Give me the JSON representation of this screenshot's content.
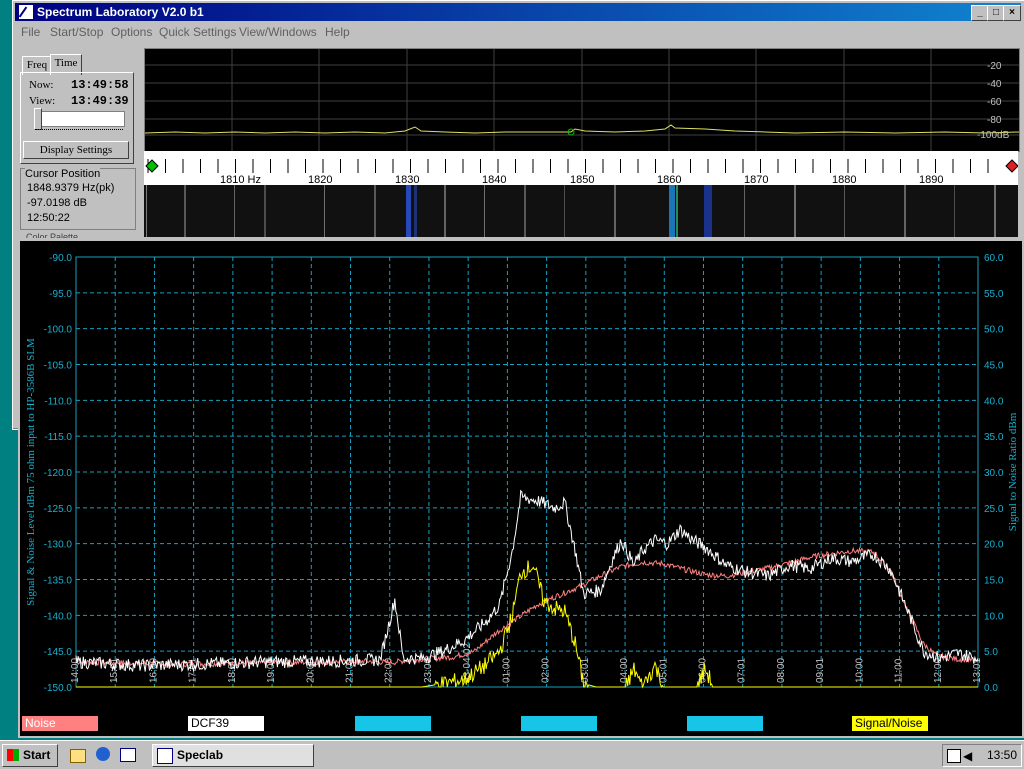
{
  "window": {
    "title": "Spectrum Laboratory V2.0 b1"
  },
  "menu": [
    "File",
    "Start/Stop",
    "Options",
    "Quick Settings",
    "View/Windows",
    "Help"
  ],
  "tabs": {
    "freq": "Freq",
    "time": "Time"
  },
  "time_panel": {
    "now_label": "Now:",
    "now_value": "13:49:58",
    "view_label": "View:",
    "view_value": "13:49:39",
    "display_settings": "Display Settings"
  },
  "cursor": {
    "title": "Cursor Position",
    "freq": "1848.9379 Hz(pk)",
    "level": "-97.0198 dB",
    "time": "12:50:22",
    "palette_label": "Color Palette"
  },
  "spectrum": {
    "db_ticks": [
      "-20",
      "-40",
      "-60",
      "-80",
      "-100dB"
    ]
  },
  "ruler": {
    "ticks": [
      "1810 Hz",
      "1820",
      "1830",
      "1840",
      "1850",
      "1860",
      "1870",
      "1880",
      "1890"
    ]
  },
  "chart_data": {
    "type": "line",
    "ylabel_left": "Signal & Noise Level dBm 75 ohm input to HP-3586B SLM",
    "ylabel_right": "Signal to Noise Ratio dBm",
    "y_left_ticks": [
      "-90.0",
      "-95.0",
      "-100.0",
      "-105.0",
      "-110.0",
      "-115.0",
      "-120.0",
      "-125.0",
      "-130.0",
      "-135.0",
      "-140.0",
      "-145.0",
      "-150.0"
    ],
    "y_right_ticks": [
      "60.0",
      "55.0",
      "50.0",
      "45.0",
      "40.0",
      "35.0",
      "30.0",
      "25.0",
      "20.0",
      "15.0",
      "10.0",
      "5.0",
      "0.0"
    ],
    "ylim_left": [
      -150,
      -90
    ],
    "ylim_right": [
      0,
      60
    ],
    "x_ticks": [
      "14:00",
      "15:01",
      "16:00",
      "17:01",
      "18:00",
      "19:01",
      "20:00",
      "21:01",
      "22:00",
      "23:00",
      "03-04-02",
      "01:00",
      "02:00",
      "03:01",
      "04:00",
      "05:01",
      "06:00",
      "07:01",
      "08:00",
      "09:01",
      "10:00",
      "11:00",
      "12:00",
      "13:01"
    ],
    "grid": true,
    "series": [
      {
        "name": "Noise",
        "color": "#ff8080",
        "points": [
          [
            0,
            -146.5
          ],
          [
            5,
            -146.8
          ],
          [
            10,
            -146.6
          ],
          [
            14,
            -146.4
          ],
          [
            15,
            -146.6
          ],
          [
            16,
            -146.2
          ],
          [
            18,
            -145.8
          ],
          [
            19,
            -145.0
          ],
          [
            20,
            -142.5
          ],
          [
            21,
            -140.5
          ],
          [
            22,
            -138.5
          ],
          [
            23,
            -137.2
          ],
          [
            24,
            -136.0
          ],
          [
            25,
            -134.5
          ],
          [
            26,
            -133.2
          ],
          [
            27,
            -132.6
          ],
          [
            28,
            -132.8
          ],
          [
            29,
            -133.6
          ],
          [
            30,
            -134.3
          ],
          [
            31,
            -134.5
          ],
          [
            32,
            -134.0
          ],
          [
            33,
            -133.4
          ],
          [
            34,
            -132.7
          ],
          [
            35,
            -131.9
          ],
          [
            36,
            -131.4
          ],
          [
            37,
            -131.0
          ],
          [
            38,
            -131.2
          ],
          [
            38.8,
            -133.5
          ],
          [
            39.6,
            -139.0
          ],
          [
            40.4,
            -144.0
          ],
          [
            41,
            -145.6
          ],
          [
            42,
            -146.1
          ],
          [
            43,
            -146.3
          ]
        ]
      },
      {
        "name": "DCF39",
        "color": "#ffffff",
        "points": [
          [
            0,
            -146.5
          ],
          [
            3,
            -147.0
          ],
          [
            6,
            -146.8
          ],
          [
            9,
            -146.5
          ],
          [
            12,
            -146.4
          ],
          [
            14.5,
            -146.2
          ],
          [
            15.2,
            -137.8
          ],
          [
            15.6,
            -146.0
          ],
          [
            16.5,
            -146.0
          ],
          [
            17.5,
            -145.0
          ],
          [
            18.5,
            -143.5
          ],
          [
            19.5,
            -141.0
          ],
          [
            20.2,
            -138.5
          ],
          [
            20.8,
            -131.0
          ],
          [
            21.2,
            -123.5
          ],
          [
            22.0,
            -124.0
          ],
          [
            22.8,
            -125.0
          ],
          [
            23.3,
            -124.3
          ],
          [
            23.8,
            -131.0
          ],
          [
            24.2,
            -137.0
          ],
          [
            25.0,
            -136.5
          ],
          [
            25.6,
            -132.0
          ],
          [
            26.0,
            -129.5
          ],
          [
            26.6,
            -133.0
          ],
          [
            27.0,
            -131.0
          ],
          [
            27.6,
            -129.5
          ],
          [
            28.2,
            -130.0
          ],
          [
            28.8,
            -128.0
          ],
          [
            29.4,
            -129.5
          ],
          [
            30.0,
            -130.5
          ],
          [
            31.0,
            -133.0
          ],
          [
            32.0,
            -134.0
          ],
          [
            33.0,
            -134.5
          ],
          [
            34.0,
            -133.0
          ],
          [
            35.0,
            -133.5
          ],
          [
            36.0,
            -132.0
          ],
          [
            37.0,
            -132.5
          ],
          [
            38.0,
            -131.5
          ],
          [
            38.8,
            -133.5
          ],
          [
            39.6,
            -139.0
          ],
          [
            40.4,
            -145.0
          ],
          [
            41.2,
            -146.0
          ],
          [
            42.0,
            -145.3
          ],
          [
            43,
            -146.0
          ]
        ]
      },
      {
        "name": "Signal/Noise",
        "color": "#ffff00",
        "points": [
          [
            0,
            0
          ],
          [
            16.5,
            0
          ],
          [
            17.5,
            0.5
          ],
          [
            18.5,
            1.0
          ],
          [
            19.5,
            3.0
          ],
          [
            20.2,
            5.0
          ],
          [
            20.8,
            10.0
          ],
          [
            21.2,
            16.0
          ],
          [
            21.8,
            17.0
          ],
          [
            22.3,
            12.0
          ],
          [
            22.8,
            11.0
          ],
          [
            23.3,
            10.5
          ],
          [
            23.8,
            6.0
          ],
          [
            24.2,
            0.5
          ],
          [
            24.8,
            0
          ],
          [
            26.2,
            0
          ],
          [
            26.6,
            2.5
          ],
          [
            27.0,
            0
          ],
          [
            27.6,
            3.0
          ],
          [
            28.0,
            0
          ],
          [
            29.6,
            0
          ],
          [
            30.0,
            2.5
          ],
          [
            30.4,
            0
          ],
          [
            43,
            0
          ]
        ]
      }
    ]
  },
  "legend": [
    {
      "label": "Noise",
      "bg": "#ff8080",
      "fg": "#ffffff"
    },
    {
      "label": "DCF39",
      "bg": "#ffffff",
      "fg": "#000000"
    },
    {
      "label": "",
      "bg": "#17c6e6",
      "fg": "#000000"
    },
    {
      "label": "",
      "bg": "#17c6e6",
      "fg": "#000000"
    },
    {
      "label": "",
      "bg": "#17c6e6",
      "fg": "#000000"
    },
    {
      "label": "Signal/Noise",
      "bg": "#ffff00",
      "fg": "#000000"
    }
  ],
  "taskbar": {
    "start": "Start",
    "task": "Speclab",
    "clock": "13:50"
  }
}
